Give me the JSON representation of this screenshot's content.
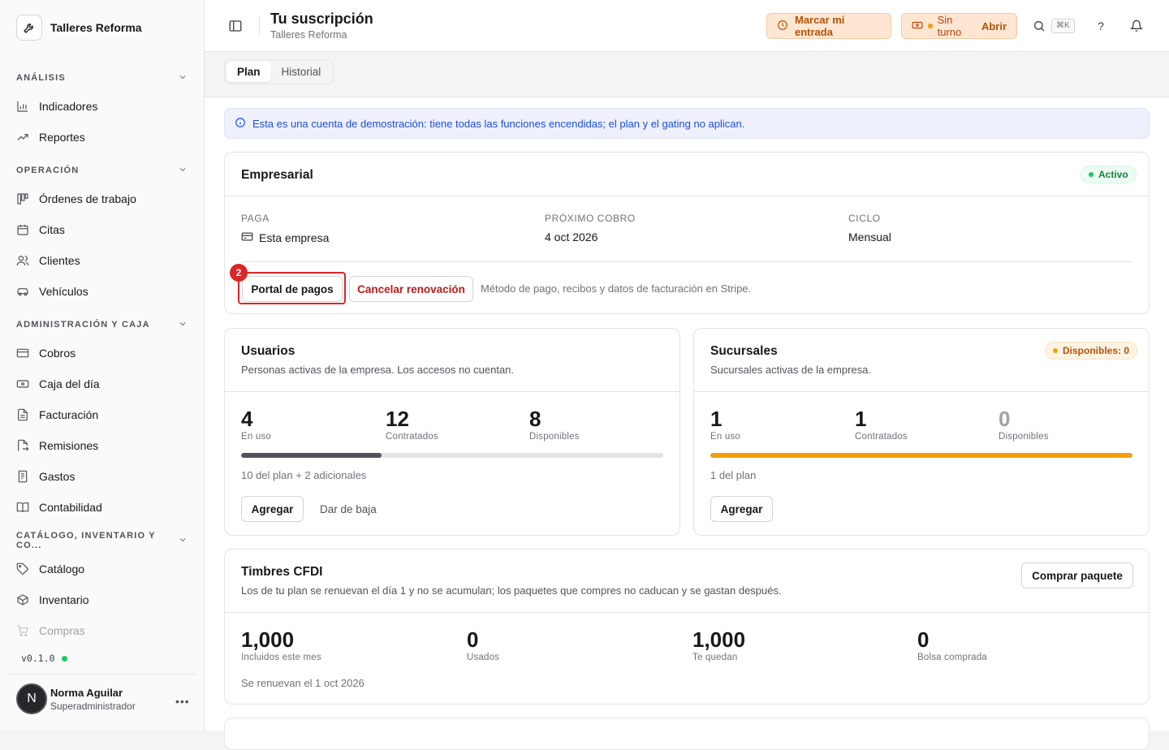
{
  "sidebar": {
    "brand_name": "Talleres Reforma",
    "sections": [
      {
        "title": "ANÁLISIS",
        "items": [
          {
            "label": "Indicadores",
            "icon": "bar-chart-icon"
          },
          {
            "label": "Reportes",
            "icon": "trending-up-icon"
          }
        ]
      },
      {
        "title": "OPERACIÓN",
        "items": [
          {
            "label": "Órdenes de trabajo",
            "icon": "kanban-icon"
          },
          {
            "label": "Citas",
            "icon": "calendar-icon"
          },
          {
            "label": "Clientes",
            "icon": "users-icon"
          },
          {
            "label": "Vehículos",
            "icon": "car-icon"
          }
        ]
      },
      {
        "title": "ADMINISTRACIÓN Y CAJA",
        "items": [
          {
            "label": "Cobros",
            "icon": "credit-card-icon"
          },
          {
            "label": "Caja del día",
            "icon": "banknote-icon"
          },
          {
            "label": "Facturación",
            "icon": "file-text-icon"
          },
          {
            "label": "Remisiones",
            "icon": "file-output-icon"
          },
          {
            "label": "Gastos",
            "icon": "receipt-icon"
          },
          {
            "label": "Contabilidad",
            "icon": "book-open-icon"
          }
        ]
      },
      {
        "title": "CATÁLOGO, INVENTARIO Y CO...",
        "items": [
          {
            "label": "Catálogo",
            "icon": "tag-icon"
          },
          {
            "label": "Inventario",
            "icon": "package-icon"
          },
          {
            "label": "Compras",
            "icon": "cart-icon"
          }
        ]
      }
    ],
    "version": "v0.1.0",
    "user": {
      "initial": "N",
      "name": "Norma Aguilar",
      "role": "Superadministrador"
    }
  },
  "topbar": {
    "title": "Tu suscripción",
    "subtitle": "Talleres Reforma",
    "clock_in_label": "Marcar mi entrada",
    "shift_status": "Sin turno",
    "shift_action": "Abrir",
    "shortcut": "⌘K",
    "help": "?"
  },
  "tabs": [
    {
      "label": "Plan",
      "active": true
    },
    {
      "label": "Historial",
      "active": false
    }
  ],
  "alert": "Esta es una cuenta de demostración: tiene todas las funciones encendidas; el plan y el gating no aplican.",
  "plan_card": {
    "name": "Empresarial",
    "status": "Activo",
    "payer_label": "PAGA",
    "payer_value": "Esta empresa",
    "next_charge_label": "PRÓXIMO COBRO",
    "next_charge_value": "4 oct 2026",
    "cycle_label": "CICLO",
    "cycle_value": "Mensual",
    "portal_button": "Portal de pagos",
    "cancel_button": "Cancelar renovación",
    "hint": "Método de pago, recibos y datos de facturación en Stripe.",
    "marker": "2"
  },
  "users_card": {
    "title": "Usuarios",
    "desc": "Personas activas de la empresa. Los accesos no cuentan.",
    "in_use": "4",
    "in_use_label": "En uso",
    "contracted": "12",
    "contracted_label": "Contratados",
    "available": "8",
    "available_label": "Disponibles",
    "usage_fraction": 0.333,
    "bar_color": "#52525b",
    "foot": "10 del plan + 2 adicionales",
    "add_button": "Agregar",
    "remove_button": "Dar de baja"
  },
  "branches_card": {
    "title": "Sucursales",
    "desc": "Sucursales activas de la empresa.",
    "badge": "Disponibles: 0",
    "in_use": "1",
    "in_use_label": "En uso",
    "contracted": "1",
    "contracted_label": "Contratados",
    "available": "0",
    "available_label": "Disponibles",
    "usage_fraction": 1.0,
    "bar_color": "#f59e0b",
    "foot": "1 del plan",
    "add_button": "Agregar"
  },
  "cfdi_card": {
    "title": "Timbres CFDI",
    "desc": "Los de tu plan se renuevan el día 1 y no se acumulan; los paquetes que compres no caducan y se gastan después.",
    "buy_button": "Comprar paquete",
    "stats": [
      {
        "value": "1,000",
        "label": "Incluidos este mes"
      },
      {
        "value": "0",
        "label": "Usados"
      },
      {
        "value": "1,000",
        "label": "Te quedan"
      },
      {
        "value": "0",
        "label": "Bolsa comprada"
      }
    ],
    "foot": "Se renuevan el 1 oct 2026"
  }
}
